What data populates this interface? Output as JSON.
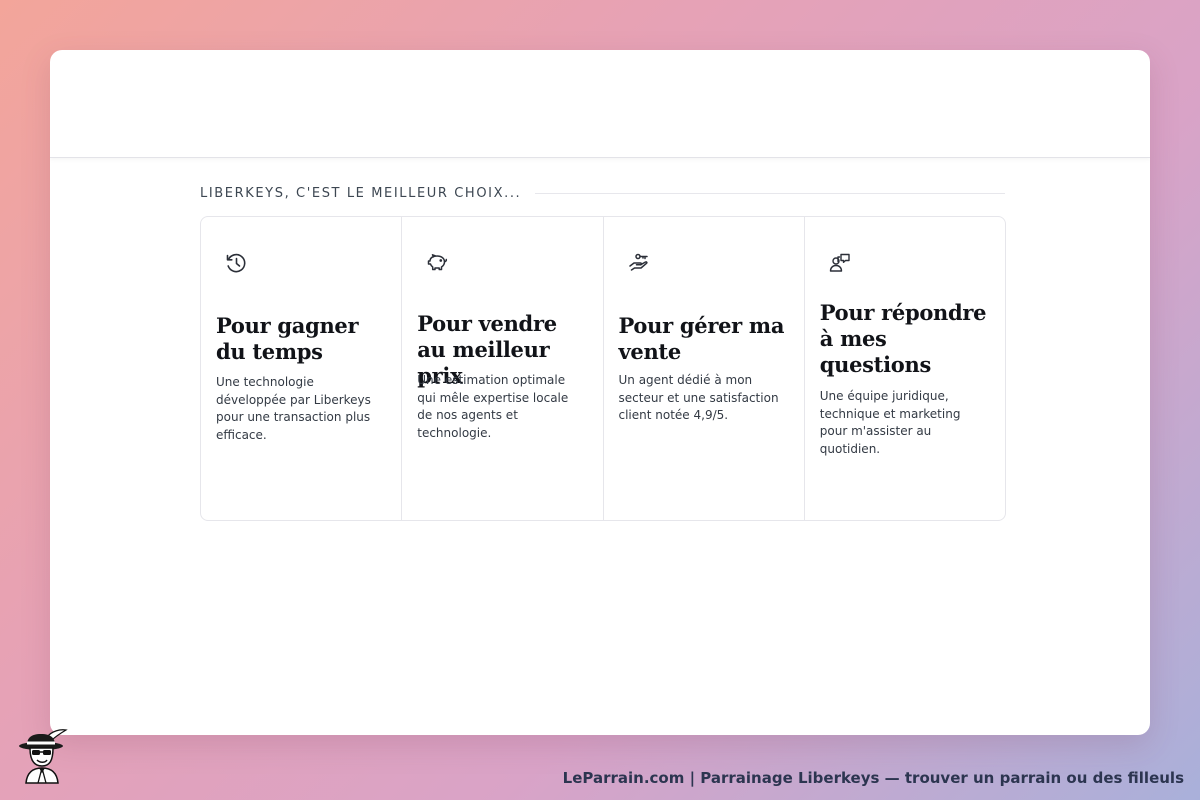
{
  "section": {
    "heading": "LIBERKEYS, C'EST LE MEILLEUR CHOIX..."
  },
  "cards": [
    {
      "icon": "history-icon",
      "title": "Pour gagner du temps",
      "text": "Une technologie développée par Liberkeys pour une transaction plus efficace."
    },
    {
      "icon": "piggy-bank-icon",
      "title": "Pour vendre au meilleur prix",
      "text": "Une estimation optimale qui mêle expertise locale de nos agents et technologie."
    },
    {
      "icon": "hand-key-icon",
      "title": "Pour gérer ma vente",
      "text": "Un agent dédié à mon secteur et une satisfaction client notée 4,9/5."
    },
    {
      "icon": "user-chat-icon",
      "title": "Pour répondre à mes questions",
      "text": "Une équipe juridique, technique et marketing pour m'assister au quotidien."
    }
  ],
  "footer": {
    "logo_icon": "detective-mascot-icon",
    "caption": "LeParrain.com | Parrainage Liberkeys — trouver un parrain ou des filleuls"
  }
}
